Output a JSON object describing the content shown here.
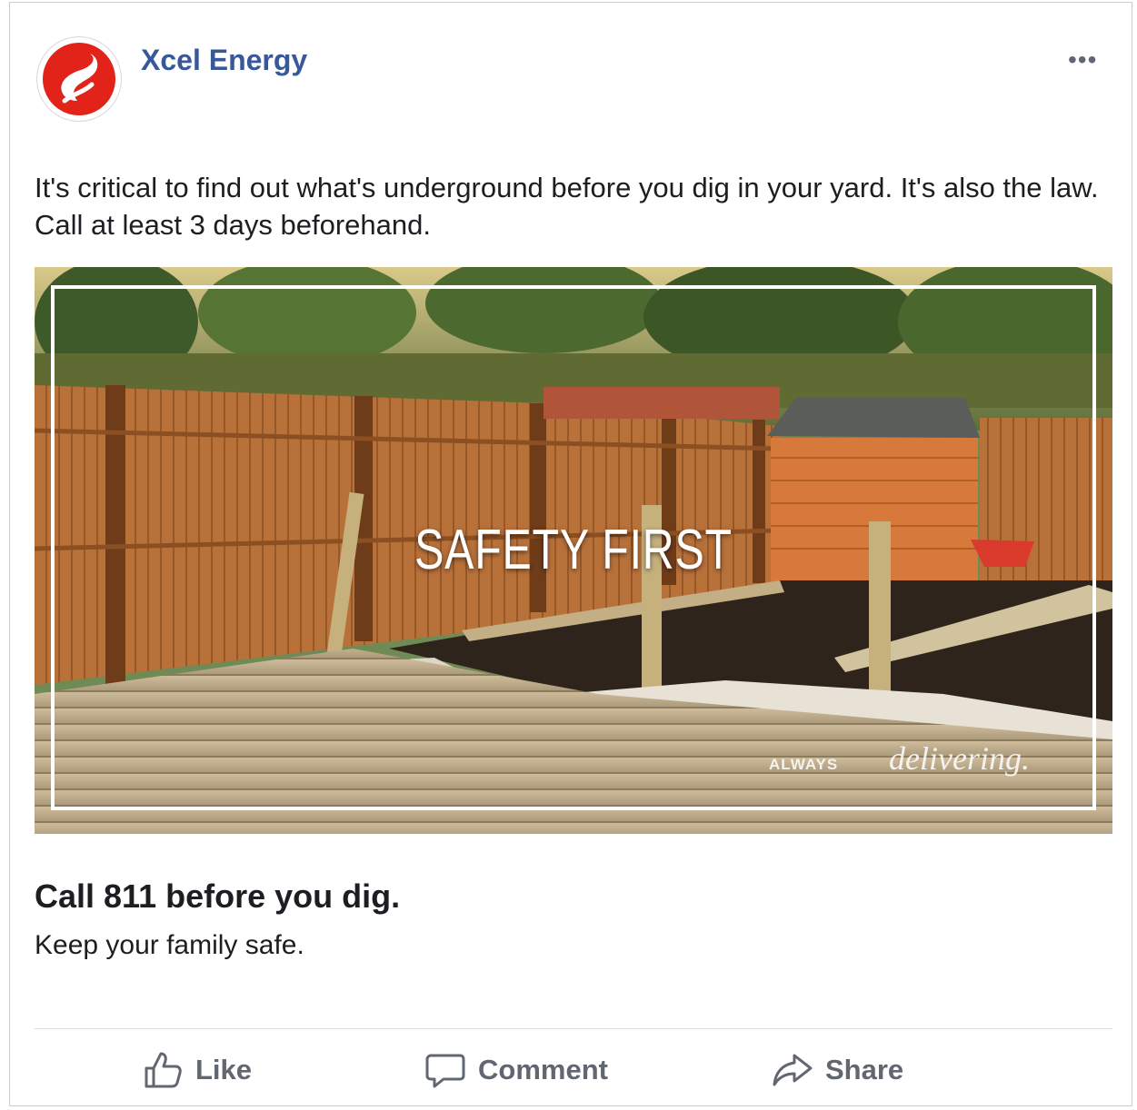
{
  "post": {
    "page_name": "Xcel Energy",
    "more_label": "•••",
    "text": "It's critical to find out what's underground before you dig in your yard. It's also the law. Call at least 3 days beforehand."
  },
  "image": {
    "overlay_title": "SAFETY FIRST",
    "tagline_small": "ALWAYS",
    "tagline_big": "delivering."
  },
  "link": {
    "headline": "Call 811 before you dig.",
    "description": "Keep your family safe."
  },
  "actions": {
    "like": "Like",
    "comment": "Comment",
    "share": "Share"
  },
  "colors": {
    "brand_name": "#385898",
    "logo_red": "#e2231a",
    "action_gray": "#606770"
  }
}
